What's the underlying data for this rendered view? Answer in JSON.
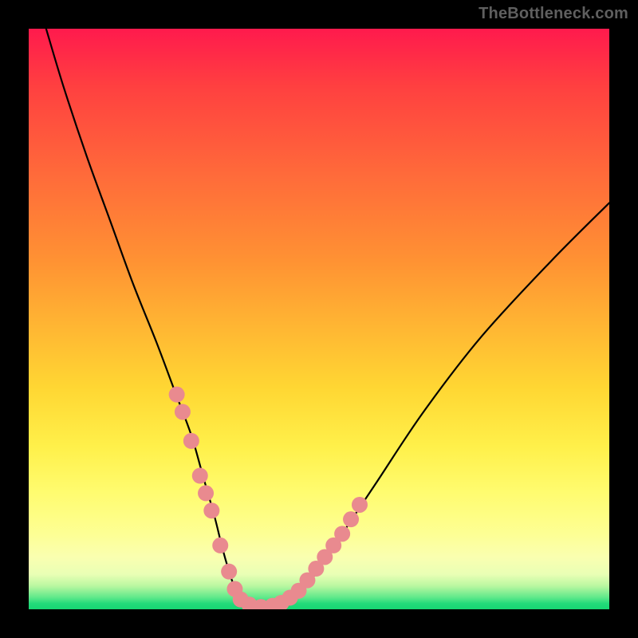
{
  "watermark": "TheBottleneck.com",
  "chart_data": {
    "type": "line",
    "title": "",
    "xlabel": "",
    "ylabel": "",
    "xlim": [
      0,
      100
    ],
    "ylim": [
      0,
      100
    ],
    "grid": false,
    "series": [
      {
        "name": "curve",
        "x": [
          3,
          6,
          10,
          14,
          18,
          22,
          25,
          28,
          30,
          32,
          33.5,
          35,
          36,
          37,
          38,
          40,
          42,
          44,
          47,
          50,
          54,
          60,
          68,
          78,
          90,
          100
        ],
        "values": [
          100,
          90,
          78,
          67,
          56,
          46,
          38,
          30,
          23,
          16,
          10,
          5,
          2.5,
          1,
          0.5,
          0.2,
          0.5,
          1.2,
          3,
          7,
          13,
          22,
          34,
          47,
          60,
          70
        ]
      }
    ],
    "markers": {
      "name": "pink-dots",
      "color": "#e98a8f",
      "points": [
        {
          "x": 25.5,
          "y": 37
        },
        {
          "x": 26.5,
          "y": 34
        },
        {
          "x": 28,
          "y": 29
        },
        {
          "x": 29.5,
          "y": 23
        },
        {
          "x": 30.5,
          "y": 20
        },
        {
          "x": 31.5,
          "y": 17
        },
        {
          "x": 33,
          "y": 11
        },
        {
          "x": 34.5,
          "y": 6.5
        },
        {
          "x": 35.5,
          "y": 3.5
        },
        {
          "x": 36.5,
          "y": 1.7
        },
        {
          "x": 38,
          "y": 0.8
        },
        {
          "x": 40,
          "y": 0.4
        },
        {
          "x": 42,
          "y": 0.6
        },
        {
          "x": 43.5,
          "y": 1.1
        },
        {
          "x": 45,
          "y": 2
        },
        {
          "x": 46.5,
          "y": 3.2
        },
        {
          "x": 48,
          "y": 5
        },
        {
          "x": 49.5,
          "y": 7
        },
        {
          "x": 51,
          "y": 9
        },
        {
          "x": 52.5,
          "y": 11
        },
        {
          "x": 54,
          "y": 13
        },
        {
          "x": 55.5,
          "y": 15.5
        },
        {
          "x": 57,
          "y": 18
        }
      ]
    }
  }
}
